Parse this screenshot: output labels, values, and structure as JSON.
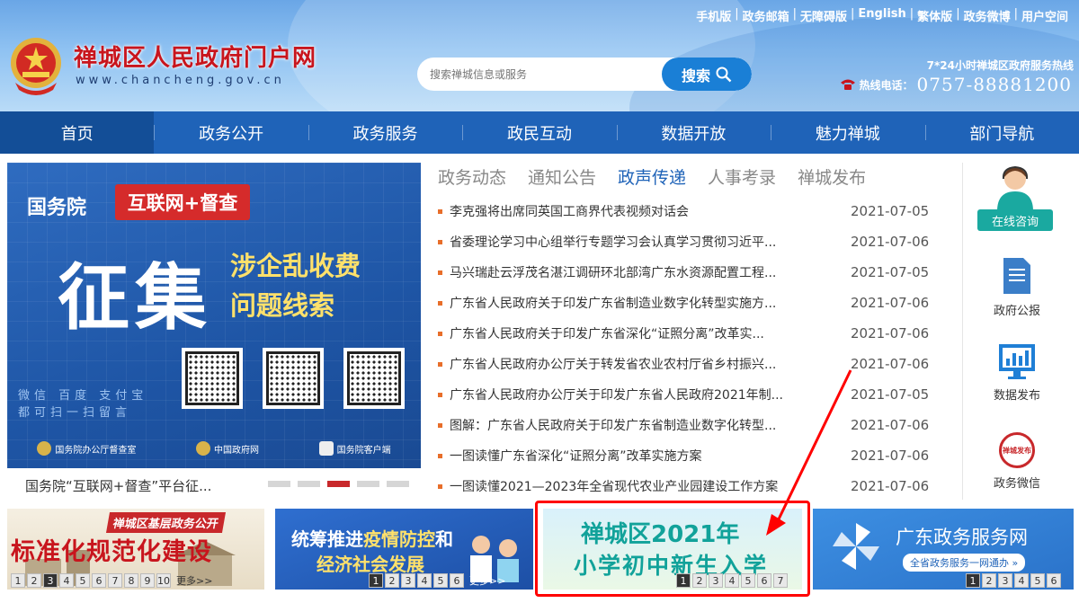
{
  "header": {
    "site_title": "禅城区人民政府门户网",
    "site_domain": "www.chancheng.gov.cn",
    "top_links": [
      "手机版",
      "政务邮箱",
      "无障碍版",
      "English",
      "繁体版",
      "政务微博",
      "用户空间"
    ],
    "search": {
      "placeholder": "搜索禅城信息或服务",
      "button_label": "搜索"
    },
    "hotline_caption": "7*24小时禅城区政府服务热线",
    "hotline_label": "热线电话：",
    "hotline_number": "0757-88881200"
  },
  "nav": {
    "items": [
      "首页",
      "政务公开",
      "政务服务",
      "政民互动",
      "数据开放",
      "魅力禅城",
      "部门导航"
    ],
    "active_index": 0
  },
  "banner": {
    "org": "国务院",
    "tag": "互联网+督查",
    "big": "征集",
    "line1": "涉企乱收费",
    "line2": "问题线索",
    "small1": "微信 百度 支付宝",
    "small2": "都可扫一扫留言",
    "foot": [
      "国务院办公厅督查室",
      "中国政府网",
      "国务院客户端"
    ],
    "caption": "国务院“互联网+督查”平台征...",
    "dots": 5,
    "active_dot": 2
  },
  "news": {
    "tabs": [
      "政务动态",
      "通知公告",
      "政声传递",
      "人事考录",
      "禅城发布"
    ],
    "active_tab": 2,
    "items": [
      {
        "title": "李克强将出席同英国工商界代表视频对话会",
        "date": "2021-07-05"
      },
      {
        "title": "省委理论学习中心组举行专题学习会认真学习贯彻习近平...",
        "date": "2021-07-06"
      },
      {
        "title": "马兴瑞赴云浮茂名湛江调研环北部湾广东水资源配置工程...",
        "date": "2021-07-05"
      },
      {
        "title": "广东省人民政府关于印发广东省制造业数字化转型实施方...",
        "date": "2021-07-06"
      },
      {
        "title": "广东省人民政府关于印发广东省深化“证照分离”改革实...",
        "date": "2021-07-06"
      },
      {
        "title": "广东省人民政府办公厅关于转发省农业农村厅省乡村振兴...",
        "date": "2021-07-06"
      },
      {
        "title": "广东省人民政府办公厅关于印发广东省人民政府2021年制...",
        "date": "2021-07-05"
      },
      {
        "title": "图解：广东省人民政府关于印发广东省制造业数字化转型...",
        "date": "2021-07-06"
      },
      {
        "title": "一图读懂广东省深化“证照分离”改革实施方案",
        "date": "2021-07-06"
      },
      {
        "title": "一图读懂2021—2023年全省现代农业产业园建设工作方案",
        "date": "2021-07-06"
      }
    ]
  },
  "side": {
    "consult": "在线咨询",
    "items": [
      "政府公报",
      "数据发布",
      "政务微信"
    ],
    "weixin_badge": "禅城发布"
  },
  "tiles": {
    "t1": {
      "head": "禅城区基层政务公开",
      "big": "标准化规范化建设",
      "pages": [
        "1",
        "2",
        "3",
        "4",
        "5",
        "6",
        "7",
        "8",
        "9",
        "10"
      ],
      "active": 2,
      "more": "更多>>"
    },
    "t2": {
      "line1a": "统筹推进",
      "line1b": "疫情防控",
      "line1c": "和",
      "line2": "经济社会发展",
      "pages": [
        "1",
        "2",
        "3",
        "4",
        "5",
        "6"
      ],
      "active": 0,
      "more": "更多>>"
    },
    "t3": {
      "line1": "禅城区2021年",
      "line2": "小学初中新生入学",
      "pages": [
        "1",
        "2",
        "3",
        "4",
        "5",
        "6",
        "7"
      ],
      "active": 0
    },
    "t4": {
      "title": "广东政务服务网",
      "sub": "全省政务服务一网通办 »",
      "pages": [
        "1",
        "2",
        "3",
        "4",
        "5",
        "6"
      ],
      "active": 0
    }
  },
  "colors": {
    "nav_bg": "#1f63b8",
    "nav_active": "#134e97",
    "title_red": "#c8151d",
    "accent_teal": "#11a29a",
    "annotation_red": "#ff0000"
  }
}
